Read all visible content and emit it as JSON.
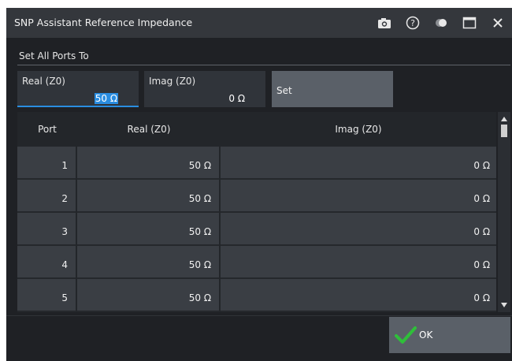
{
  "window": {
    "title": "SNP Assistant Reference Impedance",
    "icons": [
      "camera-icon",
      "help-icon",
      "toggle-icon",
      "maximize-icon",
      "close-icon"
    ]
  },
  "set_all": {
    "section_label": "Set All Ports To",
    "real_label": "Real (Z0)",
    "real_value_selected": "50 Ω",
    "imag_label": "Imag (Z0)",
    "imag_value": "0 Ω",
    "set_label": "Set"
  },
  "table": {
    "headers": {
      "port": "Port",
      "real": "Real (Z0)",
      "imag": "Imag (Z0)"
    },
    "rows": [
      {
        "port": "1",
        "real": "50 Ω",
        "imag": "0 Ω"
      },
      {
        "port": "2",
        "real": "50 Ω",
        "imag": "0 Ω"
      },
      {
        "port": "3",
        "real": "50 Ω",
        "imag": "0 Ω"
      },
      {
        "port": "4",
        "real": "50 Ω",
        "imag": "0 Ω"
      },
      {
        "port": "5",
        "real": "50 Ω",
        "imag": "0 Ω"
      }
    ]
  },
  "footer": {
    "ok_label": "OK"
  },
  "colors": {
    "accent": "#2a8de0",
    "check_green": "#2fbf3a",
    "dialog_bg": "#1f2125"
  }
}
